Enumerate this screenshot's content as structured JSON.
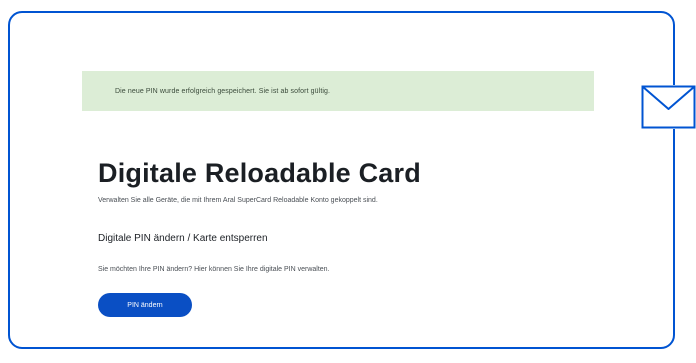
{
  "banner": {
    "message": "Die neue PIN wurde erfolgreich gespeichert. Sie ist ab sofort gültig."
  },
  "page": {
    "title": "Digitale Reloadable Card",
    "subtitle": "Verwalten Sie alle Geräte, die mit Ihrem Aral SuperCard Reloadable Konto gekoppelt sind."
  },
  "section": {
    "heading": "Digitale PIN ändern / Karte entsperren",
    "text": "Sie möchten Ihre PIN ändern? Hier können Sie Ihre digitale PIN verwalten."
  },
  "actions": {
    "change_pin_label": "PIN ändern"
  },
  "icons": {
    "mail": "mail-icon"
  },
  "colors": {
    "accent": "#0a4fc4",
    "frame_border": "#0054d2",
    "success_background": "#dcedd6"
  }
}
